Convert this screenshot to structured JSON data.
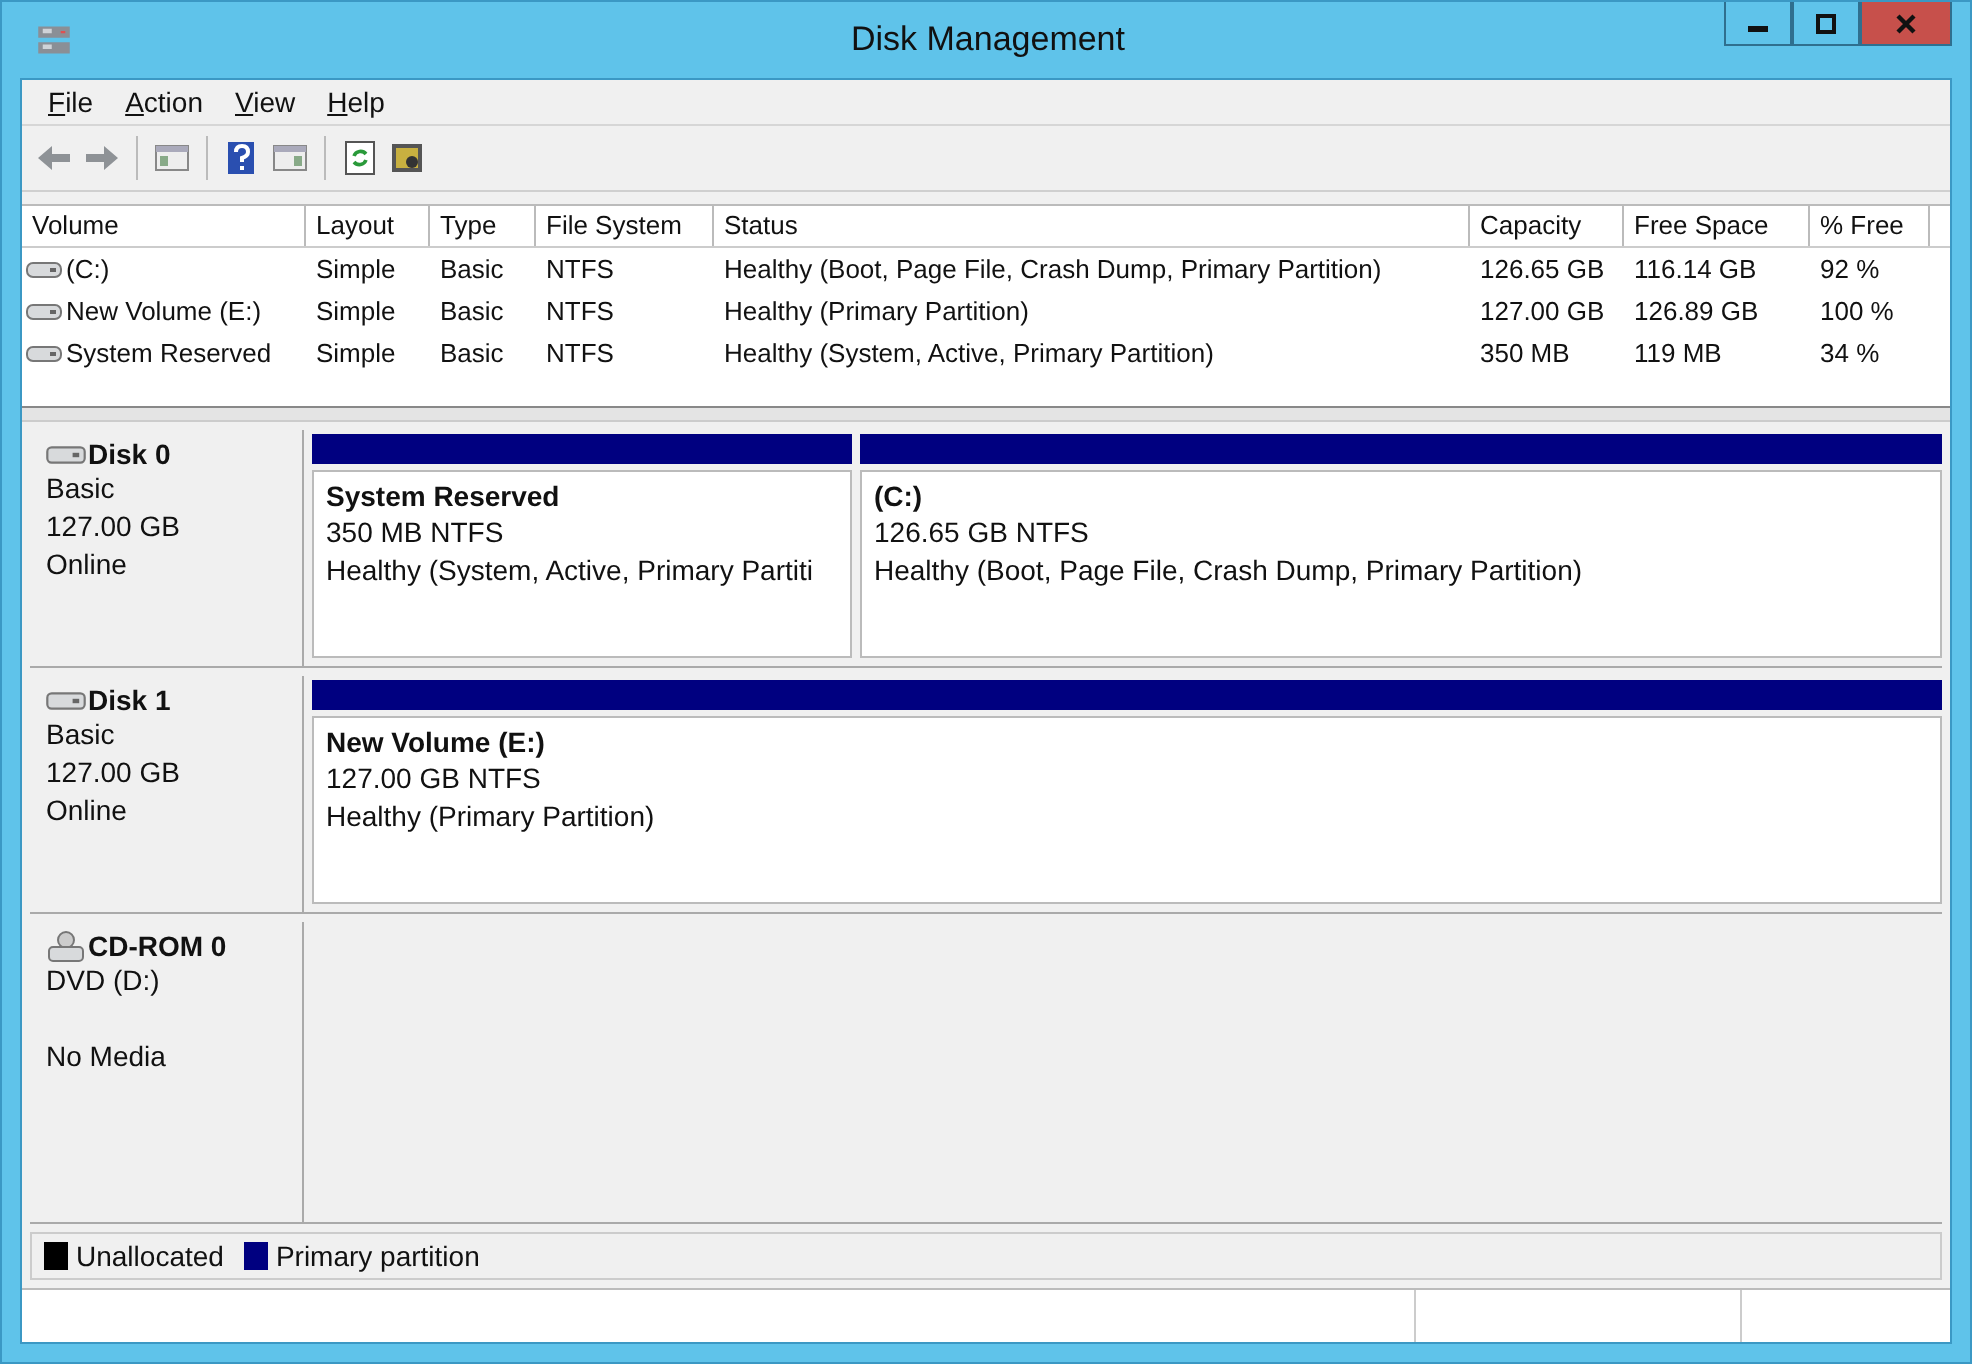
{
  "window": {
    "title": "Disk Management"
  },
  "menu": [
    {
      "label": "File"
    },
    {
      "label": "Action"
    },
    {
      "label": "View"
    },
    {
      "label": "Help"
    }
  ],
  "volume_table": {
    "columns": [
      "Volume",
      "Layout",
      "Type",
      "File System",
      "Status",
      "Capacity",
      "Free Space",
      "% Free"
    ],
    "rows": [
      [
        "(C:)",
        "Simple",
        "Basic",
        "NTFS",
        "Healthy (Boot, Page File, Crash Dump, Primary Partition)",
        "126.65 GB",
        "116.14 GB",
        "92 %"
      ],
      [
        "New Volume (E:)",
        "Simple",
        "Basic",
        "NTFS",
        "Healthy (Primary Partition)",
        "127.00 GB",
        "126.89 GB",
        "100 %"
      ],
      [
        "System Reserved",
        "Simple",
        "Basic",
        "NTFS",
        "Healthy (System, Active, Primary Partition)",
        "350 MB",
        "119 MB",
        "34 %"
      ]
    ]
  },
  "disks": [
    {
      "kind": "disk",
      "name": "Disk 0",
      "type": "Basic",
      "size": "127.00 GB",
      "status": "Online",
      "partitions": [
        {
          "color": "#000080",
          "name": "System Reserved",
          "size": "350 MB NTFS",
          "status": "Healthy (System, Active, Primary Partiti"
        },
        {
          "color": "#000080",
          "name": "(C:)",
          "size": "126.65 GB NTFS",
          "status": "Healthy (Boot, Page File, Crash Dump, Primary Partition)"
        }
      ]
    },
    {
      "kind": "disk",
      "name": "Disk 1",
      "type": "Basic",
      "size": "127.00 GB",
      "status": "Online",
      "partitions": [
        {
          "color": "#000080",
          "name": "New Volume  (E:)",
          "size": "127.00 GB NTFS",
          "status": "Healthy (Primary Partition)"
        }
      ]
    },
    {
      "kind": "cdrom",
      "name": "CD-ROM 0",
      "type": "DVD (D:)",
      "status": "No Media"
    }
  ],
  "legend": [
    {
      "label": "Unallocated",
      "color": "#000000"
    },
    {
      "label": "Primary partition",
      "color": "#000080"
    }
  ]
}
